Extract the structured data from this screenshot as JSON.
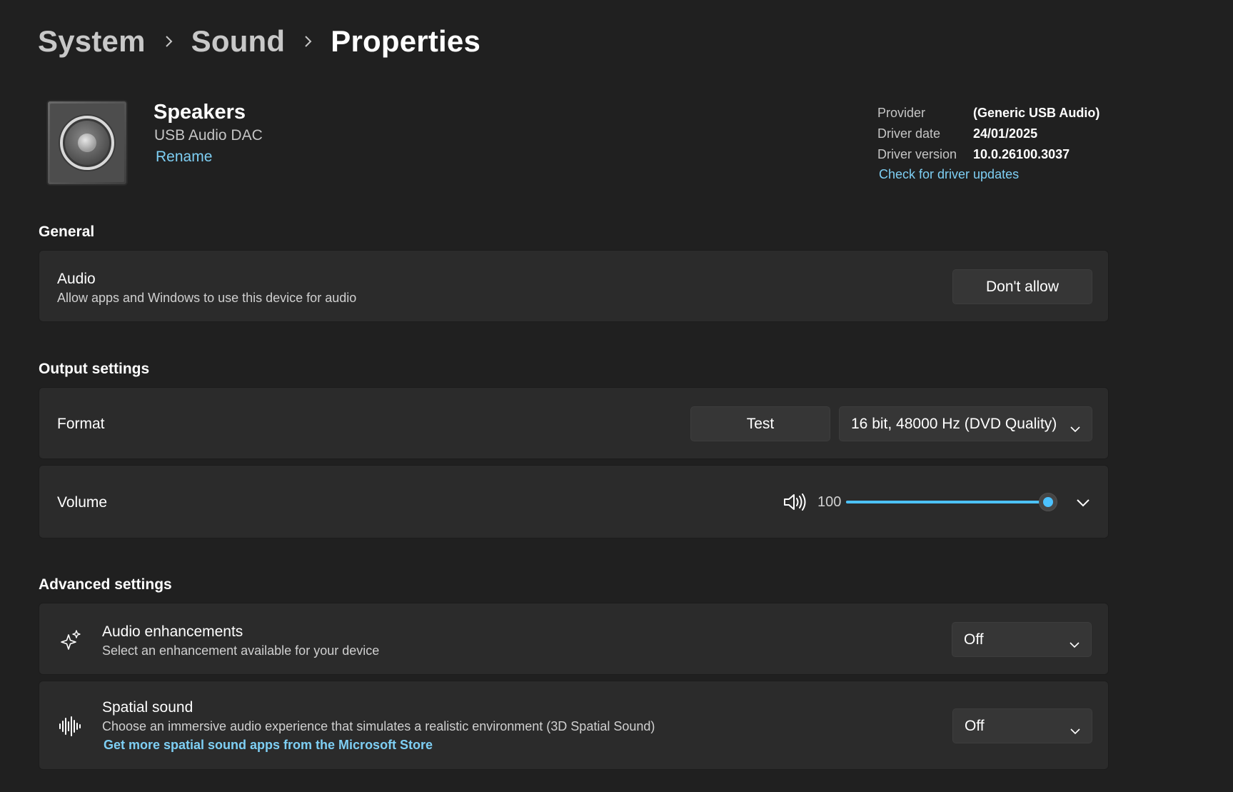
{
  "breadcrumb": {
    "items": [
      "System",
      "Sound",
      "Properties"
    ]
  },
  "device": {
    "name": "Speakers",
    "subtitle": "USB Audio DAC",
    "rename_label": "Rename",
    "icon": "speaker-icon"
  },
  "driver": {
    "rows": [
      {
        "key": "Provider",
        "value": "(Generic USB Audio)"
      },
      {
        "key": "Driver date",
        "value": "24/01/2025"
      },
      {
        "key": "Driver version",
        "value": "10.0.26100.3037"
      }
    ],
    "update_link": "Check for driver updates"
  },
  "general": {
    "title": "General",
    "audio": {
      "title": "Audio",
      "description": "Allow apps and Windows to use this device for audio",
      "button_label": "Don't allow"
    }
  },
  "output": {
    "title": "Output settings",
    "format": {
      "title": "Format",
      "test_label": "Test",
      "selected": "16 bit, 48000 Hz (DVD Quality)"
    },
    "volume": {
      "title": "Volume",
      "value": "100",
      "level": 1.0,
      "icon": "volume-icon"
    }
  },
  "advanced": {
    "title": "Advanced settings",
    "enhancements": {
      "title": "Audio enhancements",
      "description": "Select an enhancement available for your device",
      "selected": "Off",
      "icon": "sparkle-icon"
    },
    "spatial": {
      "title": "Spatial sound",
      "description": "Choose an immersive audio experience that simulates a realistic environment (3D Spatial Sound)",
      "store_link": "Get more spatial sound apps from the Microsoft Store",
      "selected": "Off",
      "icon": "sound-wave-icon"
    }
  },
  "colors": {
    "background": "#202020",
    "card": "#2b2b2b",
    "accent": "#4cc2ff",
    "link": "#7ecff4"
  }
}
